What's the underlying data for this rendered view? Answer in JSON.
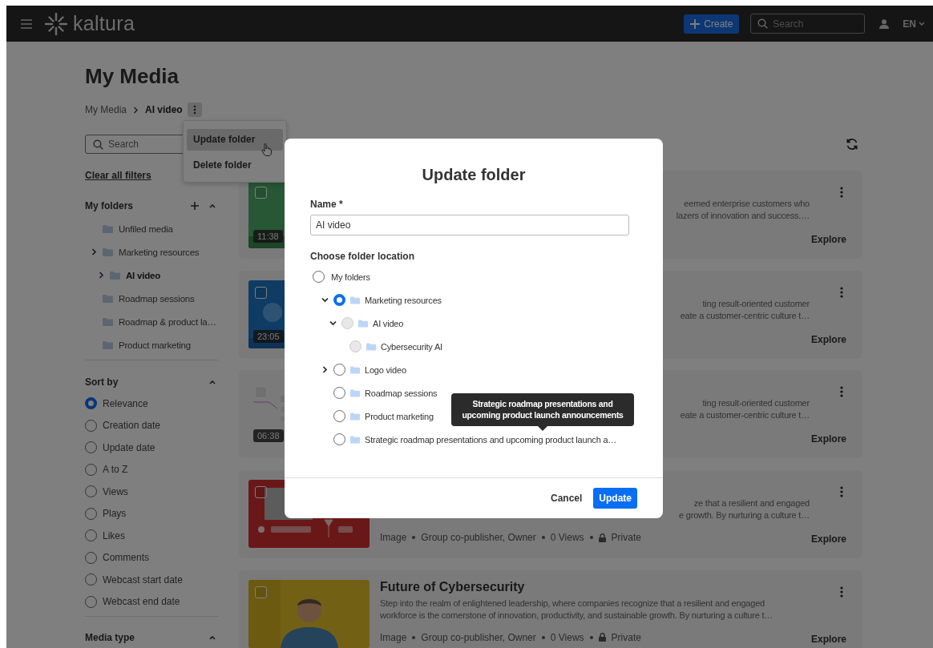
{
  "topbar": {
    "logo_text": "kaltura",
    "create_label": "Create",
    "search_placeholder": "Search",
    "language": "EN"
  },
  "page": {
    "title": "My Media",
    "breadcrumb": [
      {
        "label": "My Media",
        "current": false
      },
      {
        "label": "AI video",
        "current": true
      }
    ]
  },
  "folder_menu": [
    {
      "label": "Update folder",
      "selected": true
    },
    {
      "label": "Delete folder",
      "selected": false
    }
  ],
  "sidebar": {
    "search_placeholder": "Search",
    "clear_filters": "Clear all filters",
    "folders_title": "My folders",
    "folders": [
      {
        "label": "Unfiled media",
        "selected": false
      },
      {
        "label": "Marketing resources",
        "selected": false,
        "expanded": false,
        "children": [
          {
            "label": "AI video",
            "selected": true,
            "expanded": false
          }
        ]
      },
      {
        "label": "Roadmap sessions",
        "selected": false
      },
      {
        "label": "Roadmap & product la…",
        "selected": false
      },
      {
        "label": "Product marketing",
        "selected": false
      }
    ],
    "sort_title": "Sort by",
    "sort_options": [
      {
        "label": "Relevance",
        "selected": true
      },
      {
        "label": "Creation date",
        "selected": false
      },
      {
        "label": "Update date",
        "selected": false
      },
      {
        "label": "A to Z",
        "selected": false
      },
      {
        "label": "Views",
        "selected": false
      },
      {
        "label": "Plays",
        "selected": false
      },
      {
        "label": "Likes",
        "selected": false
      },
      {
        "label": "Comments",
        "selected": false
      },
      {
        "label": "Webcast start date",
        "selected": false
      },
      {
        "label": "Webcast end date",
        "selected": false
      }
    ],
    "media_type_title": "Media type"
  },
  "media": [
    {
      "checked": false,
      "duration": "11:38",
      "description_lines": [
        "eemed enterprise customers who",
        "lazers of innovation and success.…"
      ],
      "action": "Explore"
    },
    {
      "checked": false,
      "duration": "23:05",
      "description_lines": [
        "ting result-oriented customer",
        "eate a customer-centric culture t…"
      ],
      "action": "Explore"
    },
    {
      "checked": false,
      "duration": "06:38",
      "description_lines": [
        "ting result-oriented customer",
        "eate a customer-centric culture t…"
      ],
      "action": "Explore"
    },
    {
      "checked": false,
      "description_lines": [
        "ze that a resilient and engaged",
        "e growth. By nurturing a culture t…"
      ],
      "meta": {
        "type": "Image",
        "roles": "Group co-publisher, Owner",
        "views": "0 Views",
        "privacy": "Private"
      },
      "action": "Explore"
    },
    {
      "checked": false,
      "title": "Future of Cybersecurity",
      "description_lines": [
        "Step into the realm of enlightened leadership, where companies recognize that a resilient and engaged",
        "workforce is the cornerstone of innovation, productivity, and sustainable growth. By nurturing a culture t…"
      ],
      "meta": {
        "type": "Image",
        "roles": "Group co-publisher, Owner",
        "views": "0 Views",
        "privacy": "Private"
      },
      "action": "Explore"
    }
  ],
  "dialog": {
    "title": "Update folder",
    "name_label": "Name *",
    "name_value": "AI video",
    "location_label": "Choose folder location",
    "location_tree": [
      {
        "label": "My folders",
        "selected": false,
        "disabled": false,
        "children": [
          {
            "label": "Marketing resources",
            "selected": true,
            "disabled": false,
            "expanded": true,
            "children": [
              {
                "label": "AI video",
                "selected": false,
                "disabled": true,
                "expanded": true,
                "children": [
                  {
                    "label": "Cybersecurity AI",
                    "selected": false,
                    "disabled": true
                  }
                ]
              }
            ]
          },
          {
            "label": "Logo video",
            "selected": false,
            "disabled": false,
            "expanded": false
          },
          {
            "label": "Roadmap sessions",
            "selected": false,
            "disabled": false
          },
          {
            "label": "Product marketing",
            "selected": false,
            "disabled": false
          },
          {
            "label": "Strategic roadmap presentations and upcoming product launch a…",
            "selected": false,
            "disabled": false
          }
        ]
      }
    ],
    "tooltip": "Strategic roadmap presentations and upcoming product launch announcements",
    "cancel_label": "Cancel",
    "update_label": "Update"
  }
}
